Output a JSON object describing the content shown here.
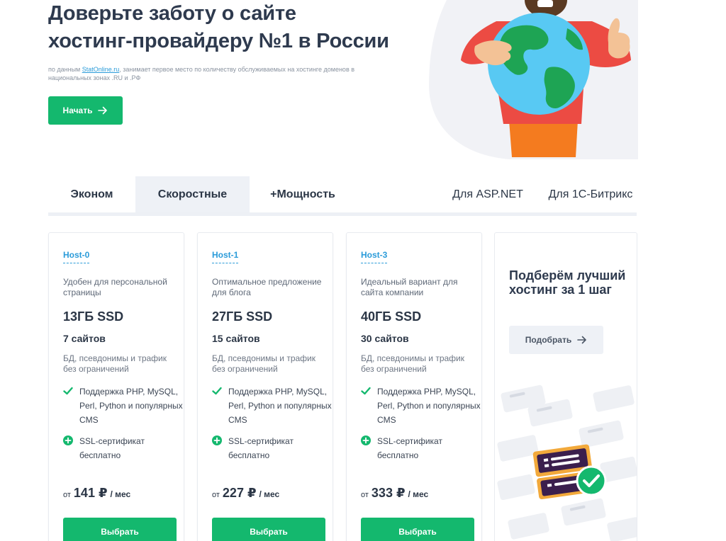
{
  "hero": {
    "title_line1": "Доверьте заботу о сайте",
    "title_line2": "хостинг-провайдеру №1 в России",
    "sub_prefix": "по данным ",
    "sub_link": "StatOnline.ru",
    "sub_suffix": ", занимает первое место по количеству обслуживаемых на хостинге доменов в национальных зонах .RU и .РФ",
    "start_label": "Начать"
  },
  "tabs": [
    {
      "label": "Эконом",
      "active": false
    },
    {
      "label": "Скоростные",
      "active": true
    },
    {
      "label": "+Мощность",
      "active": false
    },
    {
      "label": "Для ASP.NET",
      "active": false
    },
    {
      "label": "Для 1С-Битрикс",
      "active": false
    }
  ],
  "plans": [
    {
      "name": "Host-0",
      "desc": "Удобен для персональной страницы",
      "disk": "13ГБ SSD",
      "sites": "7 сайтов",
      "db": "БД, псевдонимы и трафик без ограничений",
      "feature1": "Поддержка PHP, MySQL, Perl, Python и популярных CMS",
      "feature2": "SSL-сертификат бесплатно",
      "price_from": "от",
      "price": "141 ₽",
      "price_per": "/ мес",
      "button": "Выбрать"
    },
    {
      "name": "Host-1",
      "desc": "Оптимальное предложение для блога",
      "disk": "27ГБ SSD",
      "sites": "15 сайтов",
      "db": "БД, псевдонимы и трафик без ограничений",
      "feature1": "Поддержка PHP, MySQL, Perl, Python и популярных CMS",
      "feature2": "SSL-сертификат бесплатно",
      "price_from": "от",
      "price": "227 ₽",
      "price_per": "/ мес",
      "button": "Выбрать"
    },
    {
      "name": "Host-3",
      "desc": "Идеальный вариант для сайта компании",
      "disk": "40ГБ SSD",
      "sites": "30 сайтов",
      "db": "БД, псевдонимы и трафик без ограничений",
      "feature1": "Поддержка PHP, MySQL, Perl, Python и популярных CMS",
      "feature2": "SSL-сертификат бесплатно",
      "price_from": "от",
      "price": "333 ₽",
      "price_per": "/ мес",
      "button": "Выбрать"
    }
  ],
  "pick": {
    "title": "Подберём лучший хостинг за 1 шаг",
    "button": "Подобрать"
  },
  "colors": {
    "accent_green": "#14b86e",
    "link_blue": "#2a9bd9",
    "text_dark": "#2e3a4e",
    "tab_active_bg": "#eef1f6"
  },
  "icons": {
    "start_arrow": "arrow-right-icon",
    "feature1": "check-icon",
    "feature2": "plus-circle-icon",
    "pick_arrow": "arrow-right-icon"
  }
}
